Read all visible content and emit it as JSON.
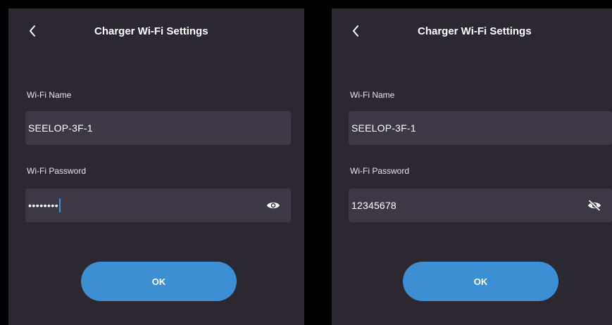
{
  "accent_color": "#3c8fd2",
  "screens": [
    {
      "title": "Charger Wi-Fi Settings",
      "back_icon": "chevron-left-icon",
      "wifi_name_label": "Wi-Fi Name",
      "wifi_name_value": "SEELOP-3F-1",
      "wifi_password_label": "Wi-Fi Password",
      "wifi_password_value": "••••••••",
      "password_visible": false,
      "visibility_icon": "eye-icon",
      "ok_label": "OK"
    },
    {
      "title": "Charger Wi-Fi Settings",
      "back_icon": "chevron-left-icon",
      "wifi_name_label": "Wi-Fi Name",
      "wifi_name_value": "SEELOP-3F-1",
      "wifi_password_label": "Wi-Fi Password",
      "wifi_password_value": "12345678",
      "password_visible": true,
      "visibility_icon": "eye-off-icon",
      "ok_label": "OK"
    }
  ]
}
